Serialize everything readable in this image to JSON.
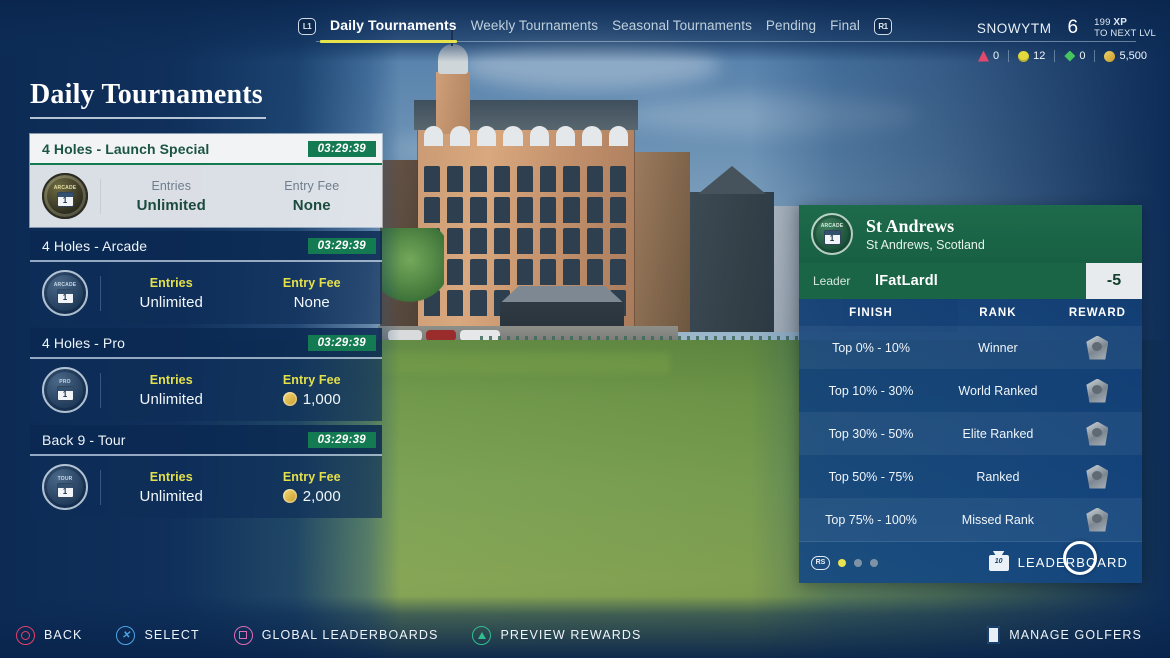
{
  "nav": {
    "left_bumper": "L1",
    "right_bumper": "R1",
    "tabs": [
      {
        "label": "Daily Tournaments",
        "active": true
      },
      {
        "label": "Weekly Tournaments",
        "active": false
      },
      {
        "label": "Seasonal Tournaments",
        "active": false
      },
      {
        "label": "Pending",
        "active": false
      },
      {
        "label": "Final",
        "active": false
      }
    ]
  },
  "user": {
    "name": "SNOWYTM",
    "level": "6",
    "xp_amount": "199",
    "xp_unit": "XP",
    "xp_caption": "TO NEXT LVL",
    "currencies": [
      {
        "icon": "red-gem-icon",
        "value": "0"
      },
      {
        "icon": "yellow-ball-icon",
        "value": "12"
      },
      {
        "icon": "green-gem-icon",
        "value": "0"
      },
      {
        "icon": "gold-coin-icon",
        "value": "5,500"
      }
    ]
  },
  "page": {
    "title": "Daily Tournaments"
  },
  "tournaments": [
    {
      "name": "4 Holes - Launch Special",
      "timer": "03:29:39",
      "tier": "ARCADE",
      "day": "1",
      "entries_label": "Entries",
      "entries_value": "Unlimited",
      "fee_label": "Entry Fee",
      "fee_value": "None",
      "fee_has_coin": false,
      "selected": true
    },
    {
      "name": "4 Holes - Arcade",
      "timer": "03:29:39",
      "tier": "ARCADE",
      "day": "1",
      "entries_label": "Entries",
      "entries_value": "Unlimited",
      "fee_label": "Entry Fee",
      "fee_value": "None",
      "fee_has_coin": false,
      "selected": false
    },
    {
      "name": "4 Holes - Pro",
      "timer": "03:29:39",
      "tier": "PRO",
      "day": "1",
      "entries_label": "Entries",
      "entries_value": "Unlimited",
      "fee_label": "Entry Fee",
      "fee_value": "1,000",
      "fee_has_coin": true,
      "selected": false
    },
    {
      "name": "Back 9 - Tour",
      "timer": "03:29:39",
      "tier": "TOUR",
      "day": "1",
      "entries_label": "Entries",
      "entries_value": "Unlimited",
      "fee_label": "Entry Fee",
      "fee_value": "2,000",
      "fee_has_coin": true,
      "selected": false
    }
  ],
  "panel": {
    "course_name": "St Andrews",
    "course_location": "St Andrews, Scotland",
    "tier": "ARCADE",
    "day": "1",
    "leader_label": "Leader",
    "leader_name": "lFatLardl",
    "leader_score": "-5",
    "table_headers": {
      "finish": "FINISH",
      "rank": "RANK",
      "reward": "REWARD"
    },
    "rows": [
      {
        "finish": "Top 0% - 10%",
        "rank": "Winner",
        "reward": "silver-medal-icon"
      },
      {
        "finish": "Top 10% - 30%",
        "rank": "World Ranked",
        "reward": "silver-medal-icon"
      },
      {
        "finish": "Top 30% - 50%",
        "rank": "Elite Ranked",
        "reward": "silver-medal-icon"
      },
      {
        "finish": "Top 50% - 75%",
        "rank": "Ranked",
        "reward": "silver-medal-icon"
      },
      {
        "finish": "Top 75% - 100%",
        "rank": "Missed Rank",
        "reward": "silver-medal-icon"
      }
    ],
    "pager": {
      "button": "RS",
      "pages": 3,
      "current": 1
    },
    "leaderboard_label": "LEADERBOARD"
  },
  "bottom_bar": {
    "actions": [
      {
        "button": "circle",
        "label": "BACK"
      },
      {
        "button": "cross",
        "label": "SELECT"
      },
      {
        "button": "square",
        "label": "GLOBAL LEADERBOARDS"
      },
      {
        "button": "triangle",
        "label": "PREVIEW REWARDS"
      }
    ],
    "right_action": {
      "button": "touchpad",
      "label": "MANAGE GOLFERS"
    }
  },
  "colors": {
    "accent_yellow": "#e4e04a",
    "timer_green": "#137a52",
    "panel_green": "#1d6b4b",
    "panel_blue": "#113c71"
  }
}
